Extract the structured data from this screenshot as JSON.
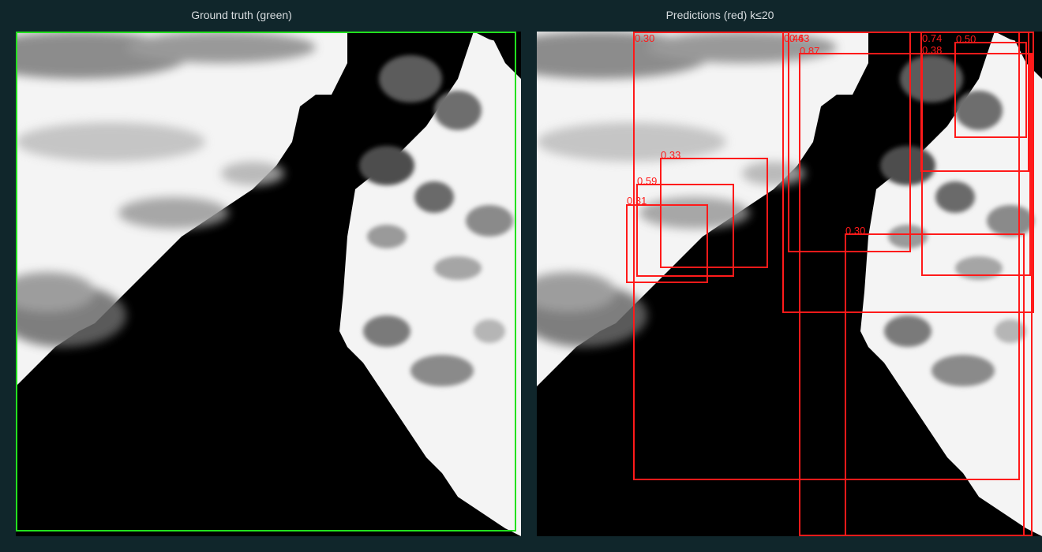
{
  "headers": {
    "left": "Ground truth (green)",
    "right": "Predictions (red)  k≤20"
  },
  "colors": {
    "background": "#10262b",
    "ground_truth": "#22e01e",
    "prediction": "#ff1a1a"
  },
  "prediction_scores": [
    "0.30",
    "0.46",
    "0.43",
    "0.87",
    "0.74",
    "0.50",
    "0.38",
    "0.33",
    "0.59",
    "0.31",
    "0.30"
  ]
}
